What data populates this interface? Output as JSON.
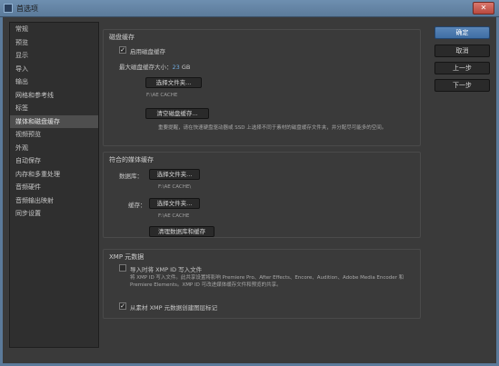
{
  "window": {
    "title": "首选项",
    "close_label": "✕"
  },
  "sidebar": {
    "items": [
      {
        "label": "常规"
      },
      {
        "label": "预览"
      },
      {
        "label": "显示"
      },
      {
        "label": "导入"
      },
      {
        "label": "输出"
      },
      {
        "label": "网格和参考线"
      },
      {
        "label": "标签"
      },
      {
        "label": "媒体和磁盘缓存"
      },
      {
        "label": "视频预览"
      },
      {
        "label": "外观"
      },
      {
        "label": "自动保存"
      },
      {
        "label": "内存和多重处理"
      },
      {
        "label": "音频硬件"
      },
      {
        "label": "音频输出映射"
      },
      {
        "label": "同步设置"
      }
    ],
    "selected_index": 7
  },
  "disk_cache": {
    "title": "磁盘缓存",
    "enable_label": "启用磁盘缓存",
    "enable_checked": true,
    "max_size_label": "最大磁盘缓存大小：",
    "max_size_value": "23",
    "max_size_unit": "GB",
    "choose_folder_label": "选择文件夹...",
    "folder_path": "F:\\AE CACHE",
    "clear_label": "清空磁盘缓存...",
    "note": "重要提醒，请在快速硬盘驱动器或 SSD 上选择不同于素材的磁盘缓存文件夹，并分配尽可能多的空间。"
  },
  "conformed_media": {
    "title": "符合的媒体缓存",
    "database_label": "数据库：",
    "database_button": "选择文件夹...",
    "database_path": "F:\\AE CACHE\\",
    "cache_label": "缓存：",
    "cache_button": "选择文件夹...",
    "cache_path": "F:\\AE CACHE",
    "clean_label": "清理数据库和缓存"
  },
  "xmp": {
    "title": "XMP 元数据",
    "write_id_label": "导入时将 XMP ID 写入文件",
    "write_id_checked": false,
    "note": "将 XMP ID 写入文件。此共享设置将影响 Premiere Pro、After Effects、Encore、Audition、Adobe Media Encoder 和 Premiere Elements。XMP ID 可改进媒体缓存文件和预览的共享。",
    "create_markers_label": "从素材 XMP 元数据创建图层标记",
    "create_markers_checked": true,
    "check_glyph": "✓"
  },
  "buttons": {
    "ok": "确定",
    "cancel": "取消",
    "prev": "上一步",
    "next": "下一步"
  }
}
